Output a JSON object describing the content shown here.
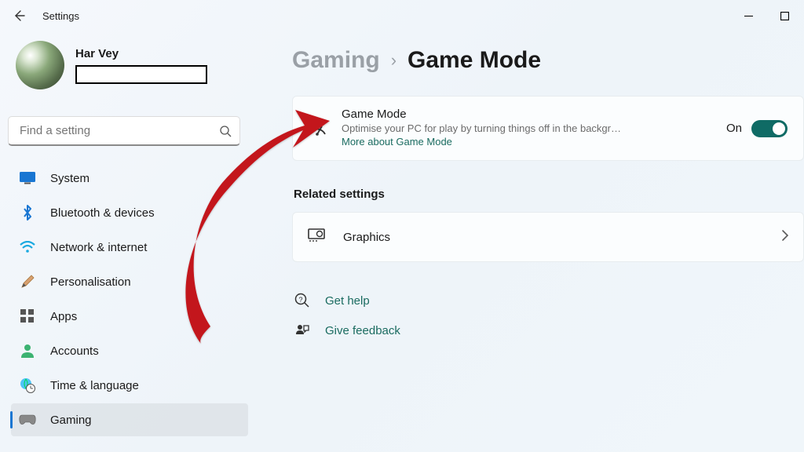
{
  "window": {
    "title": "Settings"
  },
  "profile": {
    "name": "Har Vey"
  },
  "search": {
    "placeholder": "Find a setting"
  },
  "nav": [
    {
      "id": "system",
      "label": "System"
    },
    {
      "id": "bluetooth",
      "label": "Bluetooth & devices"
    },
    {
      "id": "network",
      "label": "Network & internet"
    },
    {
      "id": "personal",
      "label": "Personalisation"
    },
    {
      "id": "apps",
      "label": "Apps"
    },
    {
      "id": "accounts",
      "label": "Accounts"
    },
    {
      "id": "time",
      "label": "Time & language"
    },
    {
      "id": "gaming",
      "label": "Gaming"
    }
  ],
  "breadcrumb": {
    "parent": "Gaming",
    "current": "Game Mode"
  },
  "gamemode_card": {
    "title": "Game Mode",
    "desc": "Optimise your PC for play by turning things off in the backgr…",
    "more": "More about Game Mode",
    "toggle_state": "On"
  },
  "related": {
    "heading": "Related settings",
    "graphics": "Graphics"
  },
  "help": {
    "get_help": "Get help",
    "feedback": "Give feedback"
  }
}
